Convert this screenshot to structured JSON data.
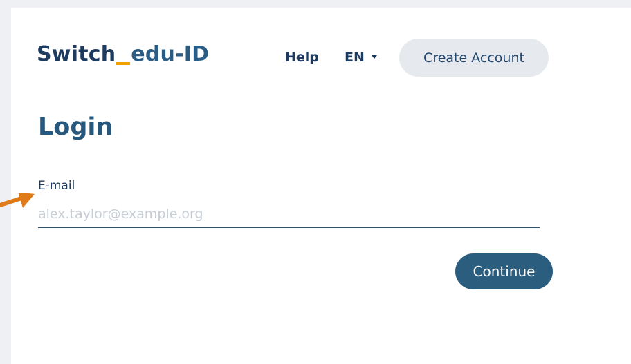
{
  "header": {
    "logo_switch": "Switch",
    "logo_eduid": "edu-ID",
    "help_label": "Help",
    "language": "EN",
    "create_account_label": "Create Account"
  },
  "login": {
    "title": "Login",
    "email_label": "E-mail",
    "email_placeholder": "alex.taylor@example.org",
    "continue_label": "Continue"
  },
  "colors": {
    "accent": "#2b5d7f",
    "logo_underscore": "#f0a000",
    "pointer_arrow": "#e07b1a"
  },
  "icons": {
    "language_caret": "chevron-down-icon",
    "pointer": "arrow-pointer-icon"
  }
}
